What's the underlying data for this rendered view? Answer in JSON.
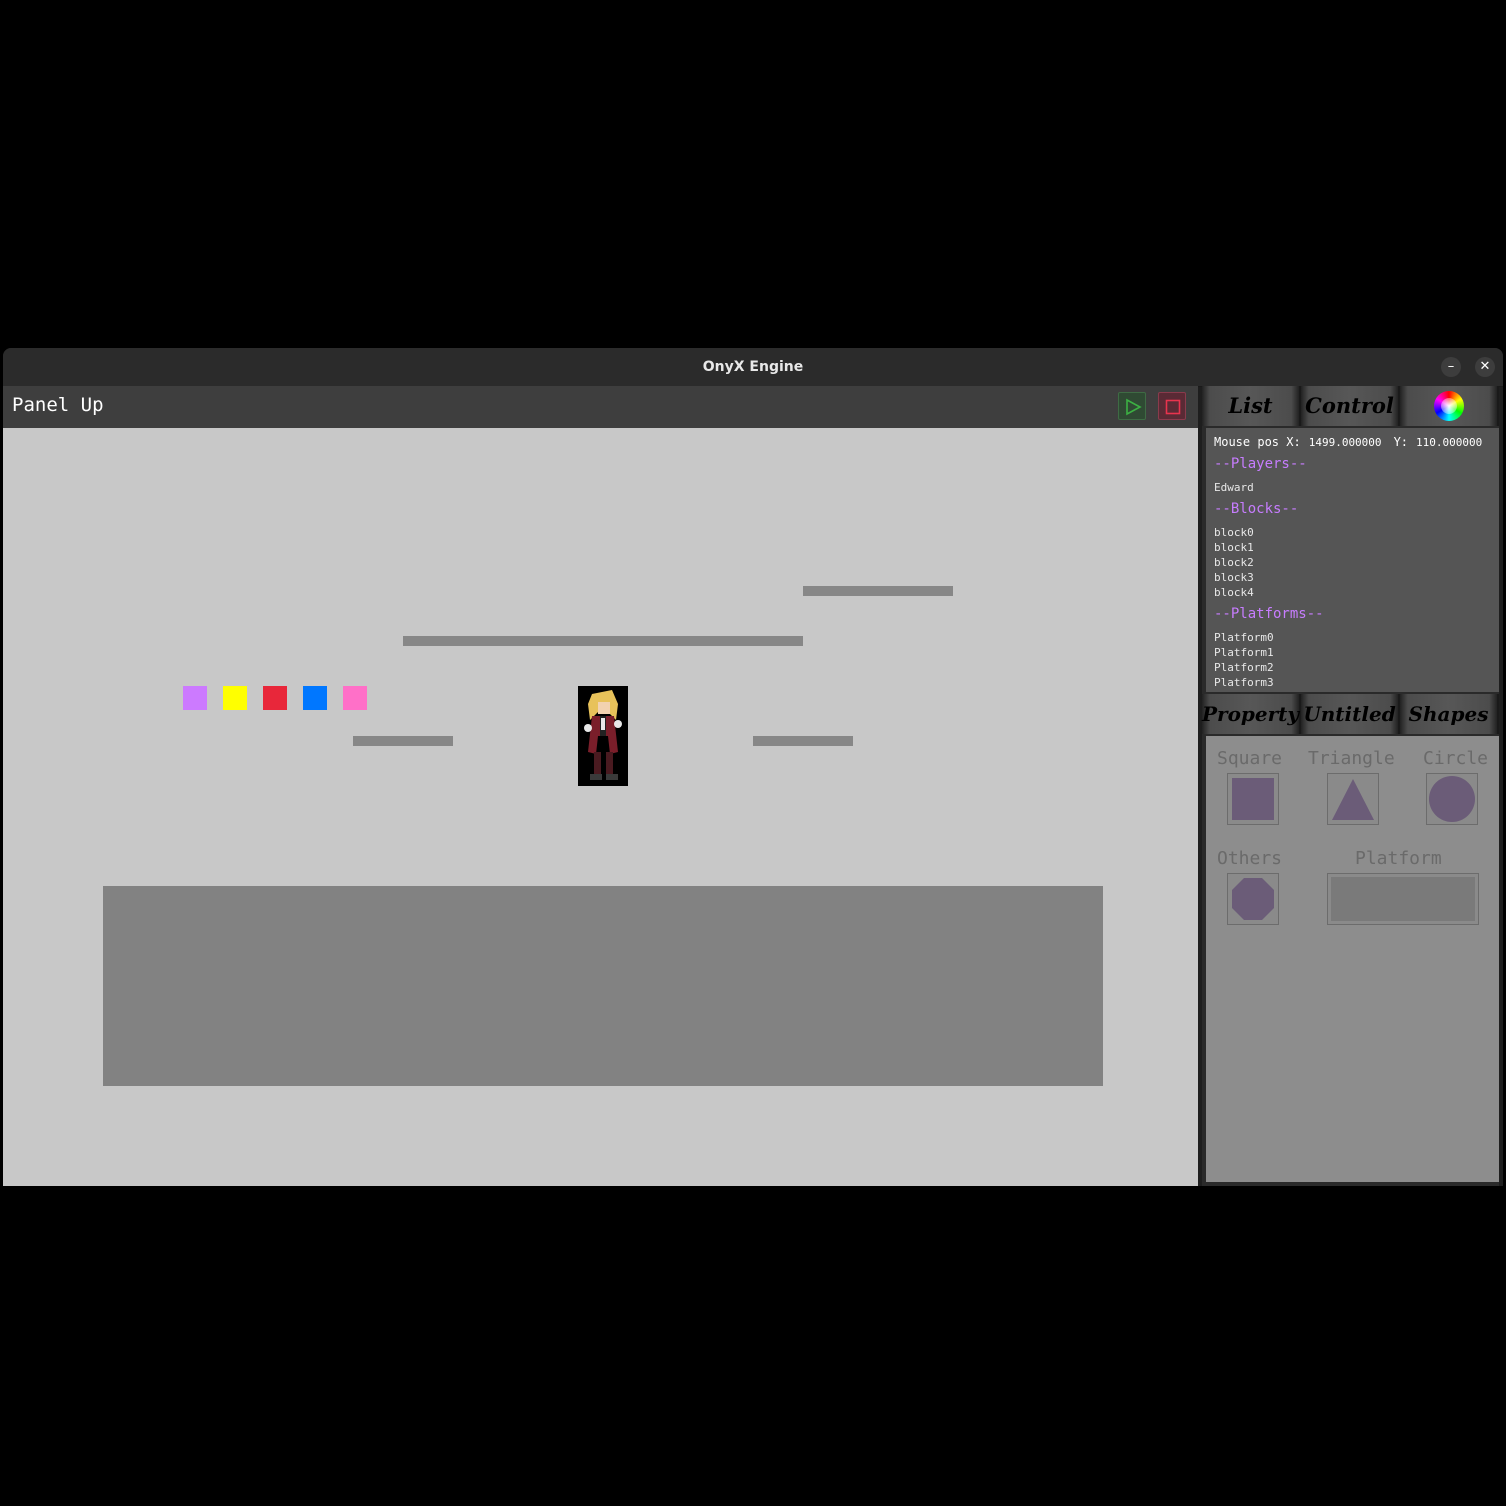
{
  "window": {
    "title": "OnyX Engine",
    "minimize_label": "–",
    "close_label": "✕"
  },
  "panel_up": {
    "label": "Panel Up",
    "play_icon": "play-icon",
    "stop_icon": "stop-icon"
  },
  "colors": {
    "play": "#3cb043",
    "stop": "#e8344e",
    "section_heading": "#c77dff",
    "shape_fill": "#6b5c78",
    "blocks": [
      "#cc7aff",
      "#ffff00",
      "#e8273a",
      "#0077ff",
      "#ff70c8"
    ]
  },
  "tabs_top": [
    {
      "label": "List"
    },
    {
      "label": "Control"
    },
    {
      "label": "",
      "icon": "color-wheel-icon"
    }
  ],
  "list": {
    "mouse_label_x": "Mouse pos X:",
    "mouse_x": "1499.000000",
    "mouse_label_y": "Y:",
    "mouse_y": "110.000000",
    "players_heading": "--Players--",
    "players": [
      "Edward"
    ],
    "blocks_heading": "--Blocks--",
    "blocks": [
      "block0",
      "block1",
      "block2",
      "block3",
      "block4"
    ],
    "platforms_heading": "--Platforms--",
    "platforms": [
      "Platform0",
      "Platform1",
      "Platform2",
      "Platform3"
    ]
  },
  "tabs_mid": [
    {
      "label": "Property"
    },
    {
      "label": "Untitled"
    },
    {
      "label": "Shapes"
    }
  ],
  "shapes": {
    "square": "Square",
    "triangle": "Triangle",
    "circle": "Circle",
    "others": "Others",
    "platform": "Platform"
  }
}
